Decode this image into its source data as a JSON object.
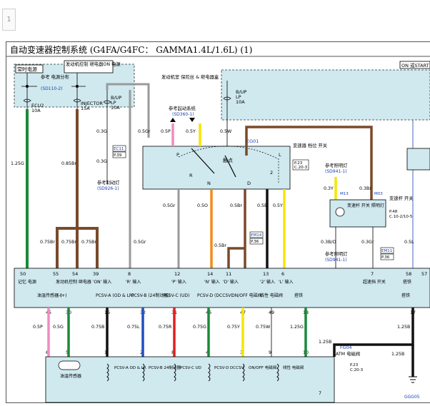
{
  "page_number": "1",
  "title": "自动变速器控制系统 (G4FA/G4FC： GAMMA1.4L/1.6L) (1)",
  "boxes": {
    "hot": "常时电源",
    "ign_on": "发动机控制 继电器ON 电源",
    "start": "ON 或START"
  },
  "fuse_labels": {
    "ref_power": "参考 电源分布",
    "ref_power_code": "(SD110-2)",
    "ecu2": "ECU2",
    "ecu2_amp": "10A",
    "injector": "INJECTOR",
    "injector_amp": "15A",
    "bup": "B/UP",
    "lp": "LP",
    "bup_amp": "10A",
    "engine_room_box": "发动机室 保险丝 & 继电器盒",
    "right_bup": "B/UP",
    "right_lp": "LP",
    "right_amp": "10A"
  },
  "refs": {
    "start_sys": "参考起动系统",
    "start_sys_code": "(SD360-1)",
    "brake_lamp": "参考制动灯",
    "brake_lamp_code": "(SD926-1)",
    "lighting1": "参考照明灯",
    "lighting1_code": "(SD941-1)",
    "lighting2": "参考照明灯",
    "lighting2_code": "(SD941-1)"
  },
  "inhibitor": {
    "label": "变速器 档位 开关",
    "ref1": "P.23",
    "ref2": "C.20-3",
    "contact": "触点",
    "gears": [
      "P",
      "R",
      "N",
      "D",
      "L",
      "2"
    ],
    "ground": "EG01"
  },
  "lever": {
    "lamp_label": "变速杆 开关 照明灯",
    "switch_label": "变速杆 开关",
    "ref1": "P.48",
    "ref2": "C.10-2/10-5",
    "m13": "M13",
    "m03": "M03"
  },
  "connectors": {
    "ec11": "EC11",
    "ec11_p": "P.39",
    "em14": "EM14",
    "em14_p": "P.36",
    "em11": "EM11",
    "em11_p": "P.36",
    "eg01": "EG01",
    "fg04": "FG04",
    "gg05": "GGG05",
    "atm_label": "ATM 电磁阀",
    "atm_p1": "P.23",
    "atm_p2": "C.20-3"
  },
  "wires_top": [
    {
      "pin": "16",
      "wire": "0.5W"
    },
    {
      "pin": "8",
      "wire": "0.3G"
    },
    {
      "pin": "5",
      "wire": "0.3G"
    },
    {
      "pin": "4",
      "wire": "0.3G"
    },
    {
      "pin": "7",
      "wire": "0.5Gr"
    },
    {
      "pin": "10",
      "wire": "0.5P"
    },
    {
      "pin": "9",
      "wire": "0.5Y"
    }
  ],
  "wires_mid": [
    {
      "label": "1.25G"
    },
    {
      "label": "0.85Br"
    },
    {
      "label": "0.75Br"
    },
    {
      "label": "0.75Br"
    },
    {
      "label": "0.75Br"
    },
    {
      "label": "0.5Gr"
    },
    {
      "label": "0.5Gr"
    },
    {
      "label": "0.5O"
    },
    {
      "label": "0.5Br"
    },
    {
      "label": "0.5B"
    },
    {
      "label": "0.5Y"
    },
    {
      "label": "0.5Br"
    },
    {
      "label": "0.3Y"
    },
    {
      "label": "0.3Br"
    },
    {
      "label": "0.3B/O"
    },
    {
      "label": "0.3Gr"
    },
    {
      "label": "0.5L"
    }
  ],
  "ecm_pins": [
    {
      "pin": "50",
      "label": "记忆 电源"
    },
    {
      "pin": "55",
      "label": ""
    },
    {
      "pin": "54",
      "label": "发动机控制 继电器 'ON' 输入"
    },
    {
      "pin": "39",
      "label": ""
    },
    {
      "pin": "8",
      "label": "'R' 输入"
    },
    {
      "pin": "12",
      "label": "'P' 输入"
    },
    {
      "pin": "14",
      "label": "'N' 输入"
    },
    {
      "pin": "11",
      "label": "'D' 输入"
    },
    {
      "pin": "13",
      "label": "'2' 输入"
    },
    {
      "pin": "6",
      "label": "'L' 输入"
    },
    {
      "pin": "7",
      "label": "超速挡 开关"
    },
    {
      "pin": "58",
      "label": "搭铁"
    },
    {
      "pin": "57",
      "label": "输入"
    }
  ],
  "ecm_bottom": [
    {
      "pin": "45",
      "label": "油温传感器 (+)",
      "wire": "0.5P",
      "cpin": "6"
    },
    {
      "pin": "30",
      "label": "(-)",
      "wire": "0.5G",
      "cpin": "5"
    },
    {
      "pin": "16",
      "label": "PCSV-A (OD & LR)",
      "wire": "0.75B",
      "cpin": "1"
    },
    {
      "pin": "32",
      "label": "PCSV-B (24制动器)",
      "wire": "0.75L",
      "cpin": "2"
    },
    {
      "pin": "31",
      "label": "PCSV-C (UD)",
      "wire": "0.75R",
      "cpin": "8"
    },
    {
      "pin": "46",
      "label": "PCSV-D (DCCSV)",
      "wire": "0.75G",
      "cpin": "4"
    },
    {
      "pin": "47",
      "label": "ON/OFF 电磁阀",
      "wire": "0.75Y",
      "cpin": "3"
    },
    {
      "pin": "49",
      "label": "线性 电磁阀",
      "wire": "0.75W",
      "cpin": "9"
    },
    {
      "pin": "18",
      "label": "搭铁",
      "wire": "1.25G",
      "cpin": "10"
    },
    {
      "pin": "17",
      "label": "搭铁",
      "wire": "1.25B",
      "cpin": ""
    }
  ],
  "solenoids": {
    "oil_temp": "油温传感器",
    "a": "PCSV-A OD & LR",
    "b": "PCSV-B 24制动器",
    "c": "PCSV-C UD",
    "d": "PCSV-D DCCSV",
    "onoff": "ON/OFF 电磁阀",
    "linear": "线性 电磁阀",
    "fg_wire": "1.25B",
    "fg_pin": "7"
  },
  "colors": {
    "green": "#1a8a3a",
    "brown": "#7a4a2a",
    "gray": "#9a9a9a",
    "pink": "#f08cc0",
    "yellow": "#f5e600",
    "orange": "#f08c1e",
    "black": "#111111",
    "blue": "#1f4fbf",
    "red": "#e02020",
    "box_fill": "#cfe9ef",
    "ref_blue": "#1a3fb0"
  }
}
